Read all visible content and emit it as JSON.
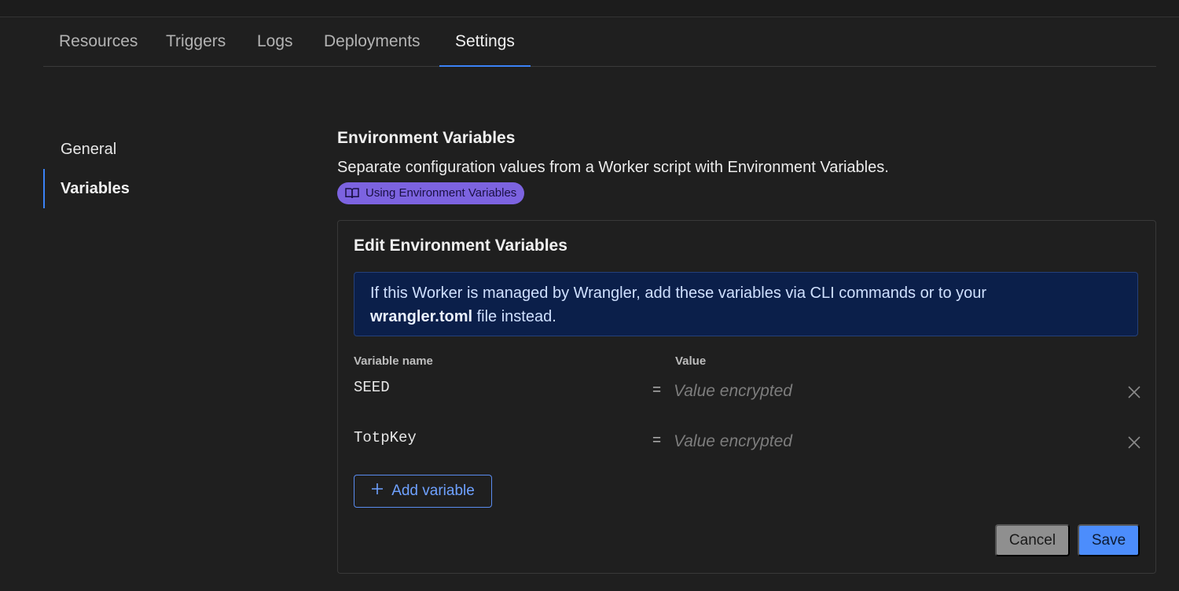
{
  "tabs": [
    {
      "label": "Resources"
    },
    {
      "label": "Triggers"
    },
    {
      "label": "Logs"
    },
    {
      "label": "Deployments"
    },
    {
      "label": "Settings",
      "active": true
    }
  ],
  "sidebar": {
    "items": [
      {
        "label": "General"
      },
      {
        "label": "Variables",
        "active": true
      }
    ]
  },
  "section": {
    "title": "Environment Variables",
    "description": "Separate configuration values from a Worker script with Environment Variables.",
    "doc_link": {
      "label": "Using Environment Variables",
      "icon": "book-open-icon"
    }
  },
  "editor": {
    "title": "Edit Environment Variables",
    "info": {
      "line1": "If this Worker is managed by Wrangler, add these variables via CLI commands or to your",
      "filename": "wrangler.toml",
      "line2_rest": " file instead."
    },
    "columns": {
      "name": "Variable name",
      "value": "Value"
    },
    "variables": [
      {
        "name": "SEED",
        "equals": "=",
        "value": "Value encrypted"
      },
      {
        "name": "TotpKey",
        "equals": "=",
        "value": "Value encrypted"
      }
    ],
    "add_label": "Add variable",
    "cancel_label": "Cancel",
    "save_label": "Save"
  },
  "colors": {
    "background": "#1f1f1f",
    "accent": "#3b82f6",
    "badge": "#7c63e0",
    "info_bg": "#0b1f4a",
    "save_bg": "#4c8dfc",
    "cancel_bg": "#8f8f8f"
  }
}
